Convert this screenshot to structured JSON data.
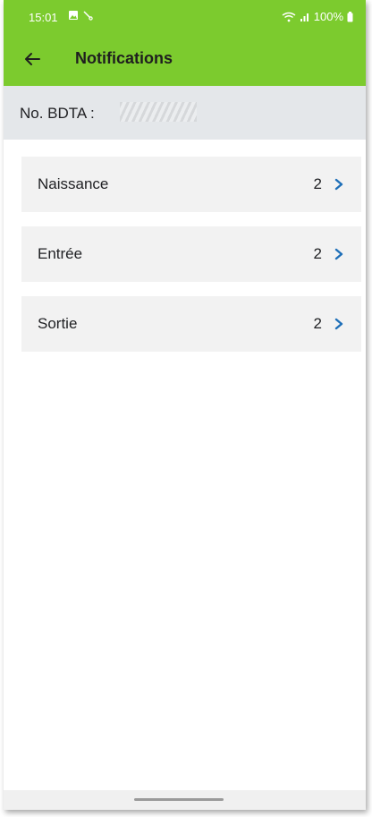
{
  "status_bar": {
    "time": "15:01",
    "battery": "100%"
  },
  "app_bar": {
    "title": "Notifications"
  },
  "bdta": {
    "label": "No. BDTA :"
  },
  "notifications": [
    {
      "label": "Naissance",
      "count": "2"
    },
    {
      "label": "Entrée",
      "count": "2"
    },
    {
      "label": "Sortie",
      "count": "2"
    }
  ],
  "colors": {
    "app_bar": "#7ccb2e",
    "chevron": "#1e6fb8",
    "info_bar": "#e4e7ea",
    "list_item": "#f2f2f2"
  }
}
